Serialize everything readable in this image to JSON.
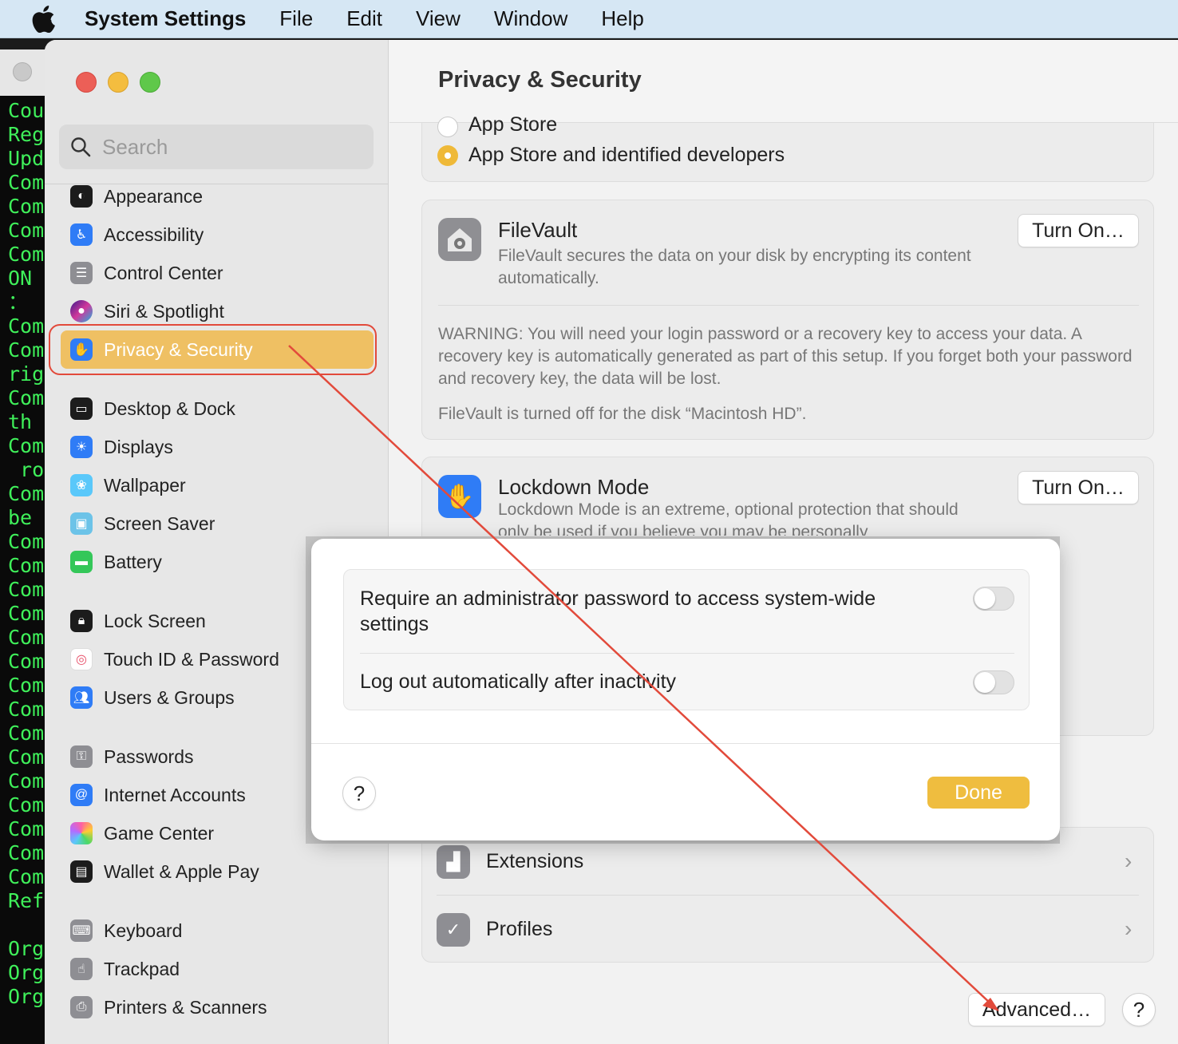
{
  "menubar": {
    "app_name": "System Settings",
    "menus": [
      "File",
      "Edit",
      "View",
      "Window",
      "Help"
    ]
  },
  "terminal": {
    "lines": [
      "Cou",
      "Reg",
      "Upd",
      "Com",
      "Com",
      "Com",
      "Com",
      "ON",
      "：",
      "Com",
      "Com",
      "rig",
      "Com",
      "th",
      "Com",
      " ro",
      "Com",
      "be",
      "Com",
      "Com",
      "Com",
      "Com",
      "Com",
      "Com",
      "Com",
      "Com",
      "Com",
      "Com",
      "Com",
      "Com",
      "Com",
      "Com",
      "Com",
      "Ref",
      "",
      "Org",
      "Org",
      "Org"
    ]
  },
  "sidebar": {
    "search_placeholder": "Search",
    "items": [
      {
        "label": "Appearance",
        "icon": "appearance-icon"
      },
      {
        "label": "Accessibility",
        "icon": "accessibility-icon"
      },
      {
        "label": "Control Center",
        "icon": "control-center-icon"
      },
      {
        "label": "Siri & Spotlight",
        "icon": "siri-icon"
      },
      {
        "label": "Privacy & Security",
        "icon": "privacy-hand-icon",
        "selected": true
      },
      {
        "label": "Desktop & Dock",
        "icon": "desktop-dock-icon"
      },
      {
        "label": "Displays",
        "icon": "displays-icon"
      },
      {
        "label": "Wallpaper",
        "icon": "wallpaper-icon"
      },
      {
        "label": "Screen Saver",
        "icon": "screen-saver-icon"
      },
      {
        "label": "Battery",
        "icon": "battery-icon"
      },
      {
        "label": "Lock Screen",
        "icon": "lock-screen-icon"
      },
      {
        "label": "Touch ID & Password",
        "icon": "touch-id-icon"
      },
      {
        "label": "Users & Groups",
        "icon": "users-groups-icon"
      },
      {
        "label": "Passwords",
        "icon": "passwords-icon"
      },
      {
        "label": "Internet Accounts",
        "icon": "internet-accounts-icon"
      },
      {
        "label": "Game Center",
        "icon": "game-center-icon"
      },
      {
        "label": "Wallet & Apple Pay",
        "icon": "wallet-icon"
      },
      {
        "label": "Keyboard",
        "icon": "keyboard-icon"
      },
      {
        "label": "Trackpad",
        "icon": "trackpad-icon"
      },
      {
        "label": "Printers & Scanners",
        "icon": "printers-icon"
      }
    ]
  },
  "content": {
    "title": "Privacy & Security",
    "allow_apps": {
      "option_app_store": "App Store",
      "option_identified": "App Store and identified developers",
      "selected": "App Store and identified developers"
    },
    "filevault": {
      "title": "FileVault",
      "description": "FileVault secures the data on your disk by encrypting its content automatically.",
      "button": "Turn On…",
      "warning": "WARNING: You will need your login password or a recovery key to access your data. A recovery key is automatically generated as part of this setup. If you forget both your password and recovery key, the data will be lost.",
      "status": "FileVault is turned off for the disk “Macintosh HD”."
    },
    "lockdown": {
      "title": "Lockdown Mode",
      "description": "Lockdown Mode is an extreme, optional protection that should only be used if you believe you may be personally",
      "button": "Turn On…"
    },
    "extensions_label": "Extensions",
    "profiles_label": "Profiles",
    "advanced_button": "Advanced…",
    "help_button": "?"
  },
  "sheet": {
    "require_admin_label": "Require an administrator password to access system-wide settings",
    "require_admin_on": false,
    "logout_label": "Log out automatically after inactivity",
    "logout_on": false,
    "help_button": "?",
    "done_button": "Done"
  },
  "colors": {
    "accent": "#efbd3f",
    "selected_sidebar": "#efc063",
    "annotation_red": "#e24a3b"
  }
}
